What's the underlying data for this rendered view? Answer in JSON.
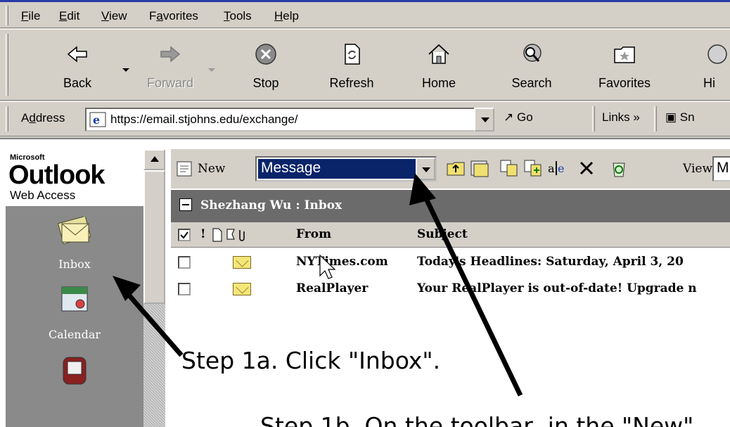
{
  "menu": {
    "items": [
      {
        "key": "F",
        "rest": "ile"
      },
      {
        "key": "E",
        "rest": "dit"
      },
      {
        "key": "V",
        "rest": "iew"
      },
      {
        "pre": "F",
        "key": "a",
        "rest": "vorites"
      },
      {
        "key": "T",
        "rest": "ools"
      },
      {
        "key": "H",
        "rest": "elp"
      }
    ]
  },
  "toolbar": {
    "back": "Back",
    "forward": "Forward",
    "stop": "Stop",
    "refresh": "Refresh",
    "home": "Home",
    "search": "Search",
    "favorites": "Favorites",
    "history": "Hi"
  },
  "address": {
    "label_pre": "A",
    "label_key": "d",
    "label_rest": "dress",
    "url": "https://email.stjohns.edu/exchange/",
    "go": "Go",
    "links": "Links »",
    "snagit": "Sn"
  },
  "nav": {
    "logo_ms": "Microsoft",
    "logo_name": "Outlook",
    "logo_sub": "Web Access",
    "items": [
      "Inbox",
      "Calendar"
    ]
  },
  "main_toolbar": {
    "new_label": "New",
    "new_selected": "Message",
    "view_label": "View",
    "view_value": "M"
  },
  "folder": {
    "title": "Shezhang Wu : Inbox"
  },
  "table": {
    "headers": {
      "importance": "!",
      "from": "From",
      "subject": "Subject"
    },
    "rows": [
      {
        "from": "NYTimes.com",
        "subject": "Today's Headlines: Saturday, April 3, 20"
      },
      {
        "from": "RealPlayer",
        "subject": "Your RealPlayer is out-of-date! Upgrade n"
      }
    ]
  },
  "annotations": {
    "step1a": "Step 1a. Click \"Inbox\".",
    "step1b": "Step 1b. On the toolbar, in the \"New\""
  }
}
